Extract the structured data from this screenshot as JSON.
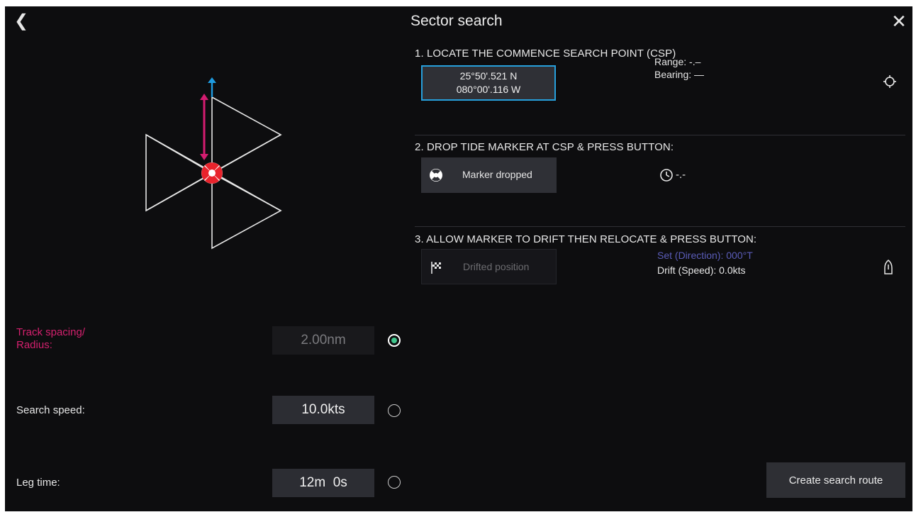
{
  "header": {
    "back_icon": "back-chevron-icon",
    "title": "Sector search",
    "close_icon": "close-icon"
  },
  "diagram": {
    "icons": [
      "north-arrow-icon",
      "spacing-double-arrow-icon",
      "datum-marker-icon"
    ],
    "colors": {
      "track": "#e8e8e8",
      "north_arrow": "#1e9be0",
      "spacing_arrow": "#d41c70",
      "marker": "#e8232c"
    }
  },
  "settings": {
    "track_spacing": {
      "label": "Track spacing/\nRadius:",
      "value": "2.00nm",
      "selected": true
    },
    "search_speed": {
      "label": "Search speed:",
      "value": "10.0kts",
      "selected": false
    },
    "leg_time": {
      "label": "Leg time:",
      "value": "12m  0s",
      "selected": false
    }
  },
  "steps": {
    "step1": {
      "heading": "1. LOCATE THE COMMENCE SEARCH POINT (CSP)",
      "lat": "25°50'.521 N",
      "lon": "080°00'.116 W",
      "range": "Range: -.–",
      "bearing": "Bearing: —",
      "icon": "crosshair-target-icon"
    },
    "step2": {
      "heading": "2. DROP TIDE MARKER AT CSP & PRESS BUTTON:",
      "button_label": "Marker dropped",
      "button_icon": "lifebuoy-icon",
      "elapsed": "-.-",
      "elapsed_icon": "clock-icon"
    },
    "step3": {
      "heading": "3. ALLOW MARKER TO DRIFT THEN RELOCATE & PRESS BUTTON:",
      "button_label": "Drifted position",
      "button_icon": "checkered-flag-icon",
      "set": "Set (Direction): 000°T",
      "drift": "Drift (Speed): 0.0kts",
      "boat_icon": "boat-icon"
    }
  },
  "footer": {
    "create_route_label": "Create search route"
  },
  "colors": {
    "accent_blue": "#27a0dc",
    "active_magenta": "#d4206e",
    "radio_on": "#3fc58c",
    "set_text": "#5a5cb8"
  }
}
